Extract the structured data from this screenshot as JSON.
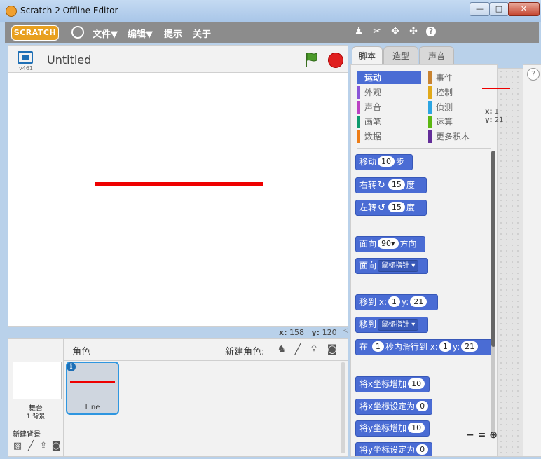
{
  "window": {
    "title": "Scratch 2 Offline Editor",
    "min": "—",
    "max": "□",
    "close": "✕"
  },
  "menu": {
    "logo": "SCRATCH",
    "file": "文件▼",
    "edit": "编辑▼",
    "tips": "提示",
    "about": "关于"
  },
  "stage": {
    "version": "v461",
    "title": "Untitled",
    "x_label": "x:",
    "x_value": "158",
    "y_label": "y:",
    "y_value": "120"
  },
  "sprites": {
    "header": "角色",
    "new_sprite": "新建角色:",
    "stage_label": "舞台",
    "backdrop_count": "1 背景",
    "new_backdrop": "新建背景",
    "sprite_name": "Line"
  },
  "tabs": [
    "脚本",
    "造型",
    "声音"
  ],
  "categories": [
    {
      "label": "运动",
      "color": "#4a6cd4"
    },
    {
      "label": "事件",
      "color": "#c88330"
    },
    {
      "label": "外观",
      "color": "#8a55d7"
    },
    {
      "label": "控制",
      "color": "#e1a91a"
    },
    {
      "label": "声音",
      "color": "#bb42c3"
    },
    {
      "label": "侦测",
      "color": "#2ca5e2"
    },
    {
      "label": "画笔",
      "color": "#0e9a6c"
    },
    {
      "label": "运算",
      "color": "#5cb712"
    },
    {
      "label": "数据",
      "color": "#ee7d16"
    },
    {
      "label": "更多积木",
      "color": "#632d99"
    }
  ],
  "blocks": {
    "move": {
      "pre": "移动",
      "val": "10",
      "post": "步"
    },
    "turn_right": {
      "pre": "右转",
      "val": "15",
      "post": "度"
    },
    "turn_left": {
      "pre": "左转",
      "val": "15",
      "post": "度"
    },
    "point_dir": {
      "pre": "面向",
      "val": "90▾",
      "post": "方向"
    },
    "point_towards": {
      "pre": "面向",
      "val": "鼠标指针 ▾"
    },
    "goto_xy": {
      "pre": "移到",
      "xl": "x:",
      "x": "1",
      "yl": "y:",
      "y": "21"
    },
    "goto": {
      "pre": "移到",
      "val": "鼠标指针 ▾"
    },
    "glide": {
      "pre": "在",
      "secs": "1",
      "mid": "秒内滑行到",
      "xl": "x:",
      "x": "1",
      "yl": "y:",
      "y": "21"
    },
    "change_x": {
      "pre": "将x坐标增加",
      "val": "10"
    },
    "set_x": {
      "pre": "将x坐标设定为",
      "val": "0"
    },
    "change_y": {
      "pre": "将y坐标增加",
      "val": "10"
    },
    "set_y": {
      "pre": "将y坐标设定为",
      "val": "0"
    }
  },
  "script_area": {
    "x_label": "x:",
    "x_value": "1",
    "y_label": "y:",
    "y_value": "21",
    "help": "?"
  }
}
